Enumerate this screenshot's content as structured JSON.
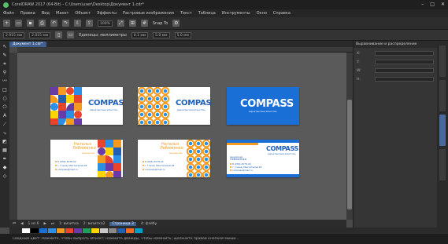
{
  "window": {
    "title": "CorelDRAW 2017 (64-Bit) - C:\\Users\\user\\Desktop\\Документ 1.cdr*"
  },
  "menu": [
    "Файл",
    "Правка",
    "Вид",
    "Макет",
    "Объект",
    "Эффекты",
    "Растровые изображения",
    "Текст",
    "Таблица",
    "Инструменты",
    "Окно",
    "Справка"
  ],
  "toolbar": {
    "zoom": "100%",
    "snap_label": "Snap To",
    "width": "2.915 мм",
    "height": "2.015 мм"
  },
  "propbar": {
    "units_label": "Единицы: миллиметры",
    "nudge": "0.1 мм",
    "dup_x": "5.0 мм",
    "dup_y": "5.0 мм"
  },
  "doc_tab": "Документ 1.cdr*",
  "cards": {
    "brand": "COMPASS",
    "tagline": "маркетинговое агентство",
    "name_line1": "Наталья",
    "name_line2": "Лебяженко",
    "role": "менеджер",
    "phone": "8 (936) 4578-42",
    "address": "г. Город, Мечтателей 28",
    "email": "compass@mail.ru"
  },
  "right_panel": {
    "title": "Выравнивание и распределение",
    "rows": [
      {
        "label": "X:"
      },
      {
        "label": "Y:"
      },
      {
        "label": "W:"
      },
      {
        "label": "H:"
      }
    ]
  },
  "page_bar": {
    "nav": "1 из 6",
    "pages": [
      "1: визитка",
      "2: визитка2",
      "Страница 3",
      "4: фэйбу"
    ]
  },
  "palette": [
    "#ffffff",
    "#000000",
    "#1a6fd6",
    "#2b8fe6",
    "#f39a1f",
    "#e8452c",
    "#6a3aa6",
    "#1e9e5a",
    "#ffd400",
    "#c8c8c8",
    "#8b8b8b",
    "#1f5fb5",
    "#f26b21",
    "#00a0c6"
  ],
  "status": {
    "text": "Сводный цвет: Нажмите, чтобы выбрать объект; нажмите дважды, чтобы изменить; щелкните правой кнопкой мыши..."
  }
}
